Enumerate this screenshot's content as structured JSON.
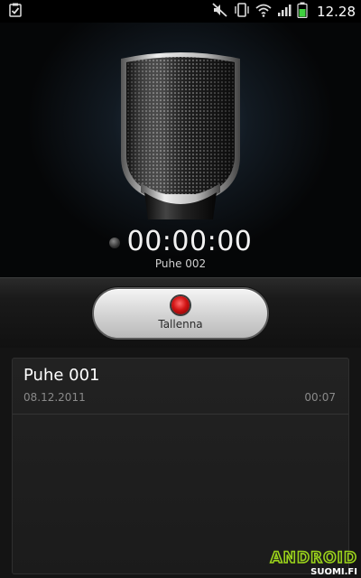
{
  "status_bar": {
    "time": "12.28",
    "icons": [
      "task-check-icon",
      "mute-icon",
      "vibrate-icon",
      "wifi-icon",
      "signal-icon",
      "battery-icon"
    ]
  },
  "recorder": {
    "timer": "00:00:00",
    "file_name": "Puhe 002",
    "record_button_label": "Tallenna"
  },
  "recordings": [
    {
      "name": "Puhe 001",
      "date": "08.12.2011",
      "duration": "00:07"
    }
  ],
  "watermark": {
    "brand": "ANDROID",
    "site": "SUOMI.FI"
  },
  "colors": {
    "record_red": "#d11414",
    "battery_green": "#3fd13f",
    "watermark_green": "#9bd31b"
  }
}
